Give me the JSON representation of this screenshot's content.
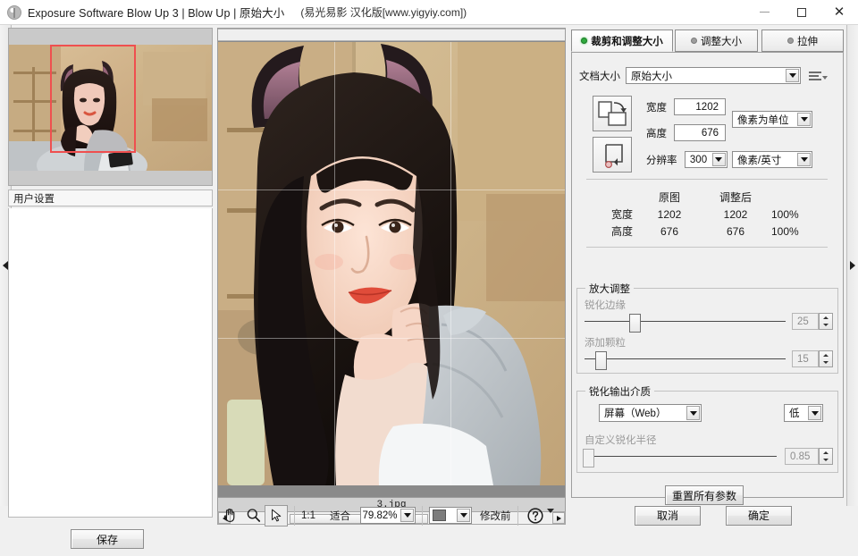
{
  "window": {
    "title": "Exposure Software Blow Up 3 | Blow Up | 原始大小",
    "subtitle": "(易光易影 汉化版[www.yigyiy.com])",
    "app_icon": "app-logo-icon",
    "minimize": "—",
    "maximize": "□",
    "close": "✕"
  },
  "left_panel": {
    "presets_header": "用户设置",
    "save_label": "保存",
    "collapse_icon": "chevron-left-icon",
    "crop_overlay_color": "#ef4f4f"
  },
  "canvas": {
    "filename": "3.jpg",
    "scroll_left_icon": "triangle-left-icon",
    "scroll_right_icon": "triangle-right-icon"
  },
  "toolbar": {
    "hand_icon": "hand-tool-icon",
    "zoom_icon": "magnifier-tool-icon",
    "pointer_icon": "arrow-pointer-tool-icon",
    "one_to_one": "1:1",
    "fit_label": "适合",
    "zoom_value": "79.82%",
    "before_label": "修改前",
    "help_icon": "question-mark-icon",
    "swatch_color": "#7d7d7d"
  },
  "right_panel": {
    "collapse_icon": "chevron-right-icon",
    "tabs": [
      {
        "label": "裁剪和调整大小",
        "active": true
      },
      {
        "label": "调整大小",
        "active": false
      },
      {
        "label": "拉伸",
        "active": false
      }
    ],
    "doc_size": {
      "label": "文档大小",
      "value": "原始大小",
      "menu_icon": "list-menu-icon"
    },
    "dimensions": {
      "swap_icon": "swap-orientation-icon",
      "lock_icon": "constrain-proportions-icon",
      "width_label": "宽度",
      "width_value": "1202",
      "height_label": "高度",
      "height_value": "676",
      "unit_value": "像素为单位",
      "resolution_label": "分辨率",
      "resolution_value": "300",
      "resolution_unit": "像素/英寸"
    },
    "compare": {
      "col_original": "原图",
      "col_resized": "调整后",
      "rows": [
        {
          "name": "宽度",
          "original": "1202",
          "resized": "1202",
          "percent": "100%"
        },
        {
          "name": "高度",
          "original": "676",
          "resized": "676",
          "percent": "100%"
        }
      ]
    },
    "enlarge_group": {
      "title": "放大调整",
      "sharpen_edges_label": "锐化边缘",
      "sharpen_edges_value": "25",
      "add_grain_label": "添加颗粒",
      "add_grain_value": "15"
    },
    "sharpen_group": {
      "title": "锐化输出介质",
      "medium_value": "屏幕（Web）",
      "amount_value": "低",
      "custom_radius_label": "自定义锐化半径",
      "custom_radius_value": "0.85"
    },
    "reset_label": "重置所有参数"
  },
  "dialog": {
    "cancel_label": "取消",
    "ok_label": "确定"
  }
}
